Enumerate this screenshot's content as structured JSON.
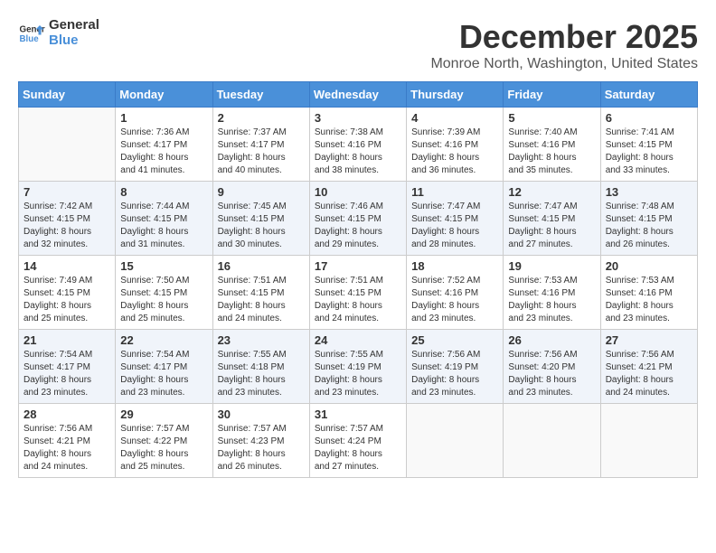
{
  "header": {
    "logo_line1": "General",
    "logo_line2": "Blue",
    "month": "December 2025",
    "location": "Monroe North, Washington, United States"
  },
  "weekdays": [
    "Sunday",
    "Monday",
    "Tuesday",
    "Wednesday",
    "Thursday",
    "Friday",
    "Saturday"
  ],
  "weeks": [
    [
      {
        "day": "",
        "info": ""
      },
      {
        "day": "1",
        "info": "Sunrise: 7:36 AM\nSunset: 4:17 PM\nDaylight: 8 hours\nand 41 minutes."
      },
      {
        "day": "2",
        "info": "Sunrise: 7:37 AM\nSunset: 4:17 PM\nDaylight: 8 hours\nand 40 minutes."
      },
      {
        "day": "3",
        "info": "Sunrise: 7:38 AM\nSunset: 4:16 PM\nDaylight: 8 hours\nand 38 minutes."
      },
      {
        "day": "4",
        "info": "Sunrise: 7:39 AM\nSunset: 4:16 PM\nDaylight: 8 hours\nand 36 minutes."
      },
      {
        "day": "5",
        "info": "Sunrise: 7:40 AM\nSunset: 4:16 PM\nDaylight: 8 hours\nand 35 minutes."
      },
      {
        "day": "6",
        "info": "Sunrise: 7:41 AM\nSunset: 4:15 PM\nDaylight: 8 hours\nand 33 minutes."
      }
    ],
    [
      {
        "day": "7",
        "info": "Sunrise: 7:42 AM\nSunset: 4:15 PM\nDaylight: 8 hours\nand 32 minutes."
      },
      {
        "day": "8",
        "info": "Sunrise: 7:44 AM\nSunset: 4:15 PM\nDaylight: 8 hours\nand 31 minutes."
      },
      {
        "day": "9",
        "info": "Sunrise: 7:45 AM\nSunset: 4:15 PM\nDaylight: 8 hours\nand 30 minutes."
      },
      {
        "day": "10",
        "info": "Sunrise: 7:46 AM\nSunset: 4:15 PM\nDaylight: 8 hours\nand 29 minutes."
      },
      {
        "day": "11",
        "info": "Sunrise: 7:47 AM\nSunset: 4:15 PM\nDaylight: 8 hours\nand 28 minutes."
      },
      {
        "day": "12",
        "info": "Sunrise: 7:47 AM\nSunset: 4:15 PM\nDaylight: 8 hours\nand 27 minutes."
      },
      {
        "day": "13",
        "info": "Sunrise: 7:48 AM\nSunset: 4:15 PM\nDaylight: 8 hours\nand 26 minutes."
      }
    ],
    [
      {
        "day": "14",
        "info": "Sunrise: 7:49 AM\nSunset: 4:15 PM\nDaylight: 8 hours\nand 25 minutes."
      },
      {
        "day": "15",
        "info": "Sunrise: 7:50 AM\nSunset: 4:15 PM\nDaylight: 8 hours\nand 25 minutes."
      },
      {
        "day": "16",
        "info": "Sunrise: 7:51 AM\nSunset: 4:15 PM\nDaylight: 8 hours\nand 24 minutes."
      },
      {
        "day": "17",
        "info": "Sunrise: 7:51 AM\nSunset: 4:15 PM\nDaylight: 8 hours\nand 24 minutes."
      },
      {
        "day": "18",
        "info": "Sunrise: 7:52 AM\nSunset: 4:16 PM\nDaylight: 8 hours\nand 23 minutes."
      },
      {
        "day": "19",
        "info": "Sunrise: 7:53 AM\nSunset: 4:16 PM\nDaylight: 8 hours\nand 23 minutes."
      },
      {
        "day": "20",
        "info": "Sunrise: 7:53 AM\nSunset: 4:16 PM\nDaylight: 8 hours\nand 23 minutes."
      }
    ],
    [
      {
        "day": "21",
        "info": "Sunrise: 7:54 AM\nSunset: 4:17 PM\nDaylight: 8 hours\nand 23 minutes."
      },
      {
        "day": "22",
        "info": "Sunrise: 7:54 AM\nSunset: 4:17 PM\nDaylight: 8 hours\nand 23 minutes."
      },
      {
        "day": "23",
        "info": "Sunrise: 7:55 AM\nSunset: 4:18 PM\nDaylight: 8 hours\nand 23 minutes."
      },
      {
        "day": "24",
        "info": "Sunrise: 7:55 AM\nSunset: 4:19 PM\nDaylight: 8 hours\nand 23 minutes."
      },
      {
        "day": "25",
        "info": "Sunrise: 7:56 AM\nSunset: 4:19 PM\nDaylight: 8 hours\nand 23 minutes."
      },
      {
        "day": "26",
        "info": "Sunrise: 7:56 AM\nSunset: 4:20 PM\nDaylight: 8 hours\nand 23 minutes."
      },
      {
        "day": "27",
        "info": "Sunrise: 7:56 AM\nSunset: 4:21 PM\nDaylight: 8 hours\nand 24 minutes."
      }
    ],
    [
      {
        "day": "28",
        "info": "Sunrise: 7:56 AM\nSunset: 4:21 PM\nDaylight: 8 hours\nand 24 minutes."
      },
      {
        "day": "29",
        "info": "Sunrise: 7:57 AM\nSunset: 4:22 PM\nDaylight: 8 hours\nand 25 minutes."
      },
      {
        "day": "30",
        "info": "Sunrise: 7:57 AM\nSunset: 4:23 PM\nDaylight: 8 hours\nand 26 minutes."
      },
      {
        "day": "31",
        "info": "Sunrise: 7:57 AM\nSunset: 4:24 PM\nDaylight: 8 hours\nand 27 minutes."
      },
      {
        "day": "",
        "info": ""
      },
      {
        "day": "",
        "info": ""
      },
      {
        "day": "",
        "info": ""
      }
    ]
  ]
}
